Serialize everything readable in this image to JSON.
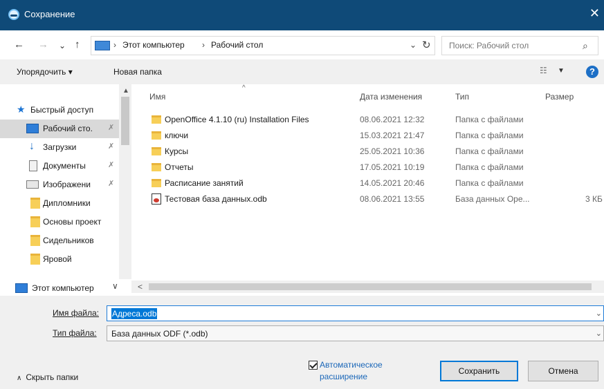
{
  "window": {
    "title": "Сохранение",
    "close_glyph": "✕"
  },
  "nav": {
    "back_glyph": "←",
    "forward_glyph": "→",
    "recent_glyph": "⌄",
    "up_glyph": "↑",
    "crumbs": [
      "Этот компьютер",
      "Рабочий стол"
    ],
    "crumb_sep": "›",
    "dropdown_glyph": "⌄",
    "refresh_glyph": "↻",
    "search_placeholder": "Поиск: Рабочий стол",
    "search_glyph": "⌕"
  },
  "toolbar": {
    "organize": "Упорядочить ▾",
    "new_folder": "Новая папка",
    "view_glyph": "☷",
    "view_caret": "▼",
    "help": "?"
  },
  "sidebar": {
    "quick_access": "Быстрый доступ",
    "items": [
      {
        "label": "Рабочий сто.",
        "icon": "monitor-icon",
        "pinned": true,
        "selected": true
      },
      {
        "label": "Загрузки",
        "icon": "downloads-icon",
        "pinned": true
      },
      {
        "label": "Документы",
        "icon": "documents-icon",
        "pinned": true
      },
      {
        "label": "Изображени",
        "icon": "pictures-icon",
        "pinned": true
      },
      {
        "label": "Дипломники",
        "icon": "folder-icon",
        "pinned": false
      },
      {
        "label": "Основы проект",
        "icon": "folder-icon",
        "pinned": false
      },
      {
        "label": "Сидельников",
        "icon": "folder-icon",
        "pinned": false
      },
      {
        "label": "Яровой",
        "icon": "folder-icon",
        "pinned": false
      }
    ],
    "this_pc": "Этот компьютер",
    "pin_glyph": "✗",
    "expand_glyph": "∨"
  },
  "files": {
    "columns": {
      "name": "Имя",
      "date": "Дата изменения",
      "type": "Тип",
      "size": "Размер"
    },
    "sort_glyph": "^",
    "rows": [
      {
        "name": "OpenOffice 4.1.10 (ru) Installation Files",
        "date": "08.06.2021 12:32",
        "type": "Папка с файлами",
        "size": "",
        "icon": "folder-icon"
      },
      {
        "name": "ключи",
        "date": "15.03.2021 21:47",
        "type": "Папка с файлами",
        "size": "",
        "icon": "folder-icon"
      },
      {
        "name": "Курсы",
        "date": "25.05.2021 10:36",
        "type": "Папка с файлами",
        "size": "",
        "icon": "folder-icon"
      },
      {
        "name": "Отчеты",
        "date": "17.05.2021 10:19",
        "type": "Папка с файлами",
        "size": "",
        "icon": "folder-icon"
      },
      {
        "name": "Расписание занятий",
        "date": "14.05.2021 20:46",
        "type": "Папка с файлами",
        "size": "",
        "icon": "folder-icon"
      },
      {
        "name": "Тестовая база данных.odb",
        "date": "08.06.2021 13:55",
        "type": "База данных Ope...",
        "size": "3 КБ",
        "icon": "database-file-icon"
      }
    ]
  },
  "scroll": {
    "up": "▲",
    "down": "▼",
    "left": "<"
  },
  "save": {
    "filename_label": "Имя файла:",
    "filename_value": "Адреса.odb",
    "filetype_label": "Тип файла:",
    "filetype_value": "База данных ODF (*.odb)",
    "caret": "⌄",
    "auto_ext": "Автоматическое расширение",
    "auto_ext_checked": true,
    "hide_folders": "Скрыть папки",
    "hide_chev": "∧",
    "save_button": "Сохранить",
    "cancel_button": "Отмена"
  }
}
